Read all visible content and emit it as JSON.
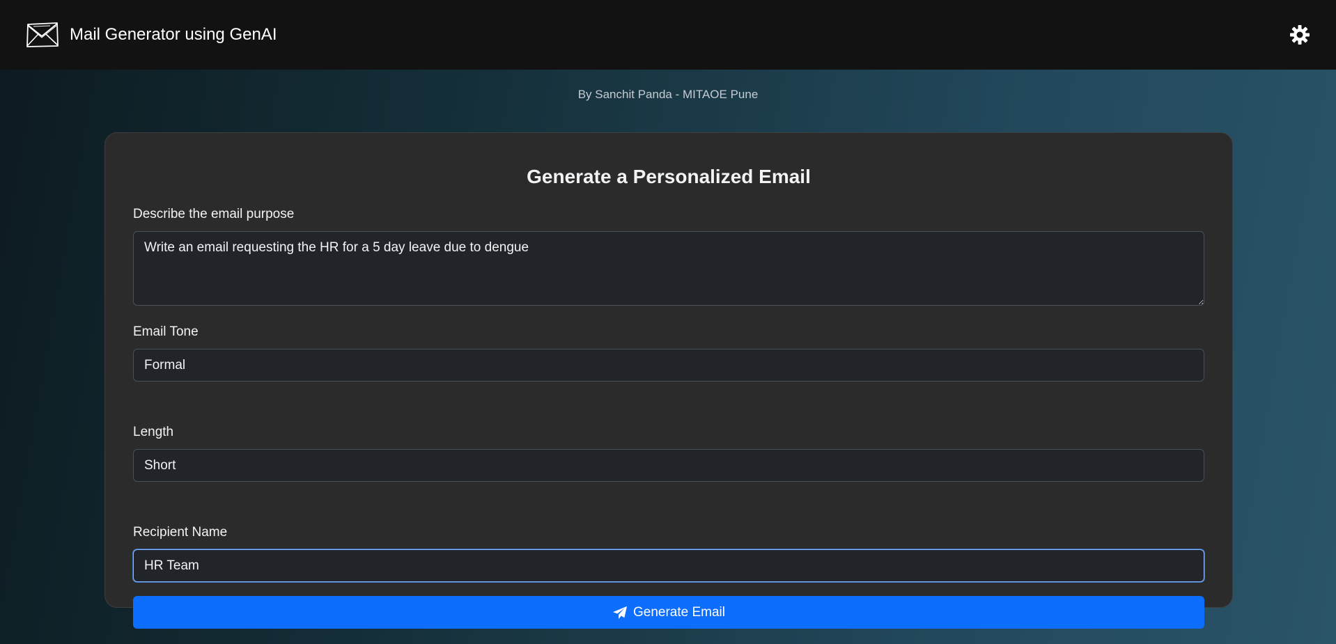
{
  "header": {
    "title": "Mail Generator using GenAI",
    "logo_icon": "envelope-icon",
    "theme_toggle_icon": "sun-icon"
  },
  "subtitle": "By Sanchit Panda - MITAOE Pune",
  "form": {
    "title": "Generate a Personalized Email",
    "purpose": {
      "label": "Describe the email purpose",
      "value": "Write an email requesting the HR for a 5 day leave due to dengue"
    },
    "tone": {
      "label": "Email Tone",
      "value": "Formal"
    },
    "length": {
      "label": "Length",
      "value": "Short"
    },
    "recipient": {
      "label": "Recipient Name",
      "value": "HR Team"
    },
    "submit": {
      "label": "Generate Email",
      "icon": "paper-plane-icon"
    }
  },
  "colors": {
    "navbar": "#121212",
    "card": "#2b2b2b",
    "input_bg": "#212529",
    "primary": "#0d6efd"
  }
}
